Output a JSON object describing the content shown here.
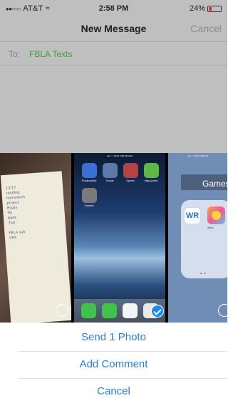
{
  "status_bar": {
    "carrier": "AT&T",
    "time": "2:58 PM",
    "battery": "24%"
  },
  "nav": {
    "title": "New Message",
    "cancel_label": "Cancel"
  },
  "compose": {
    "to_label": "To:",
    "recipient": "FBLA Texts"
  },
  "photos": {
    "notes_text": "12/17\nreading\nhomework\nproject\nEssay\nPG\nbook\n7bd\n\nFBLA sub\nVRS",
    "home_apps": [
      {
        "label": "Productivity",
        "color": "#3a6fd8",
        "icon": "folder-icon"
      },
      {
        "label": "Social",
        "color": "#5b7aa8",
        "icon": "folder-icon"
      },
      {
        "label": "Sports",
        "color": "#b84141",
        "icon": "folder-icon"
      },
      {
        "label": "MapQuest",
        "color": "#5fb846",
        "icon": "map-icon"
      },
      {
        "label": "Games",
        "color": "#7a7a7a",
        "icon": "folder-icon"
      }
    ],
    "dock_apps": [
      {
        "name": "Messages",
        "color": "#3fc34a"
      },
      {
        "name": "Phone",
        "color": "#3fc34a"
      },
      {
        "name": "Gmail",
        "color": "#f4f4f4"
      },
      {
        "name": "Chrome",
        "color": "#e9e9e9"
      }
    ],
    "games_folder_title": "Games",
    "games_apps": [
      "WR",
      "Word..."
    ],
    "selected_count": 1
  },
  "actions": {
    "send": "Send 1 Photo",
    "comment": "Add Comment",
    "cancel": "Cancel"
  },
  "colors": {
    "accent": "#2b7fd6",
    "recipient": "#3f9f3f"
  }
}
